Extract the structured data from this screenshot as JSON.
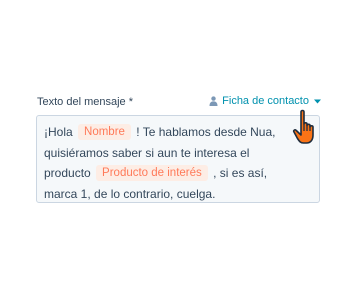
{
  "field": {
    "label": "Texto del mensaje *"
  },
  "contact_link": {
    "label": "Ficha de contacto",
    "icon": "person-icon",
    "dropdown_icon": "caret-down-icon"
  },
  "message": {
    "line1_before": "¡Hola",
    "token_name": "Nombre",
    "line1_after": "! Te hablamos desde Nua,",
    "line2": "quisiéramos saber si aun te interesa el",
    "line3_before": "producto",
    "token_product": "Producto de interés",
    "line3_after": ", si es así,",
    "line4": "marca 1, de lo contrario, cuelga."
  },
  "cursor": {
    "icon": "hand-pointer-icon"
  },
  "colors": {
    "link": "#0091ae",
    "token_text": "#ff7a59",
    "token_bg": "#fdede5",
    "box_bg": "#f5f8fa",
    "box_border": "#cbd6e2",
    "cursor_fill": "#f97316"
  }
}
